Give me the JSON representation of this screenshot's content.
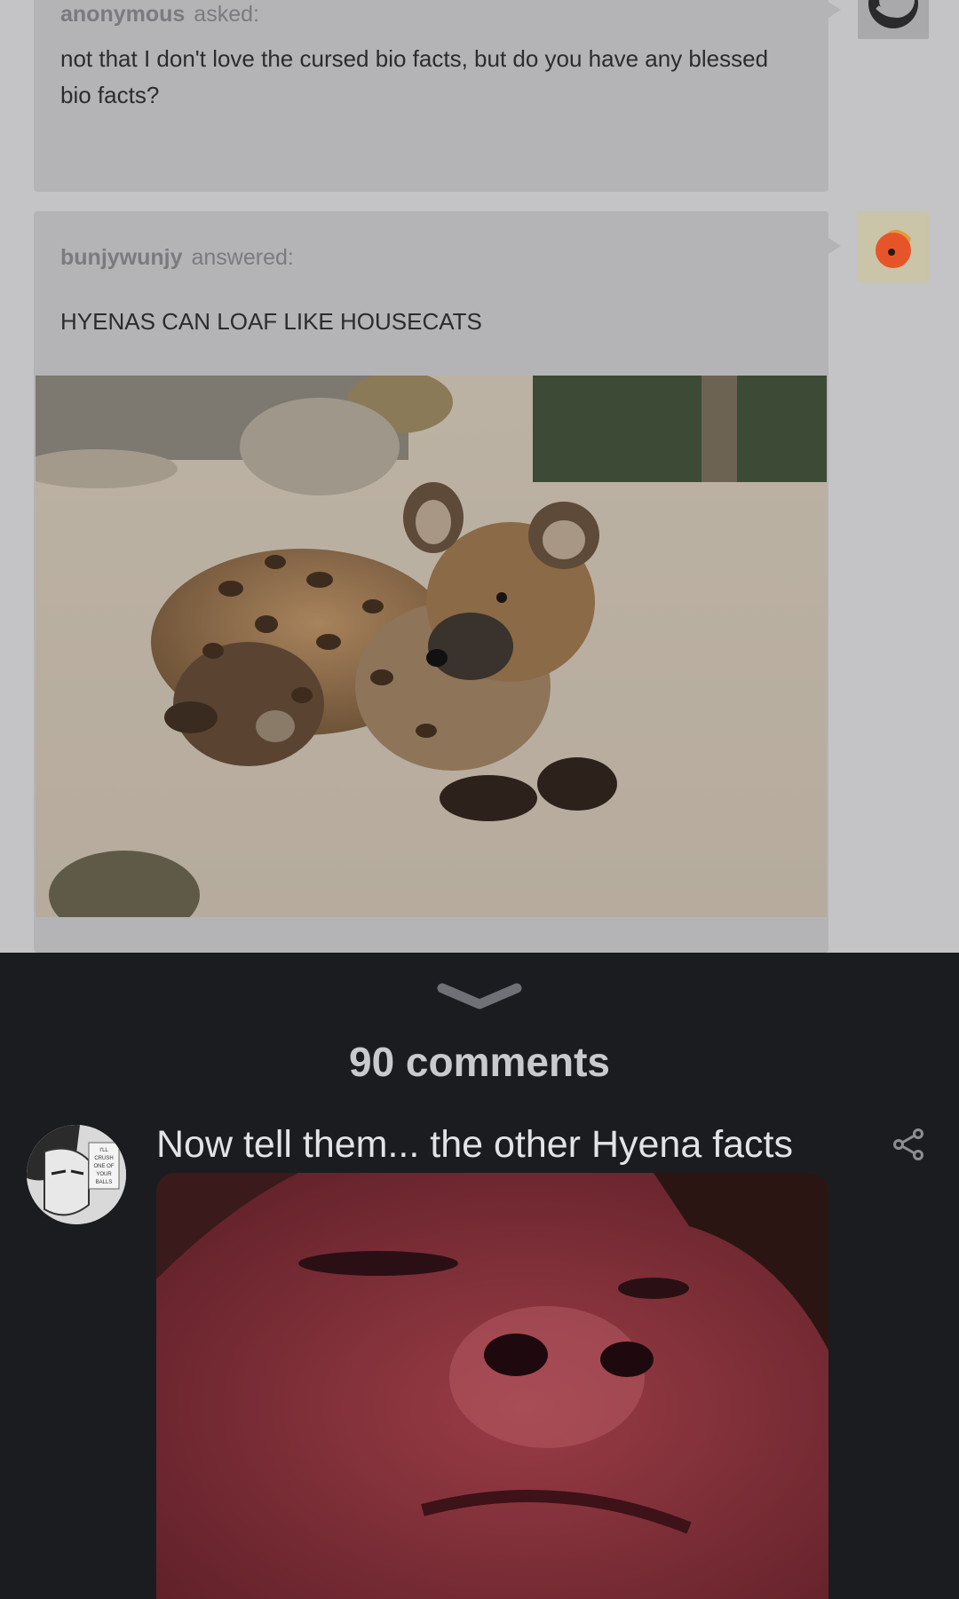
{
  "ask": {
    "username": "anonymous",
    "action": "asked:",
    "text": "not that I don't love the cursed bio facts, but do you have any blessed bio facts?"
  },
  "answer": {
    "username": "bunjywunjy",
    "action": "answered:",
    "text": "HYENAS CAN LOAF LIKE HOUSECATS",
    "image_icon": "hyena-photo"
  },
  "sheet": {
    "handle_icon": "chevron-down-icon",
    "comments_count": "90 comments"
  },
  "comment": {
    "text": "Now tell them... the other Hyena facts",
    "share_icon": "share-icon",
    "avatar_caption": [
      "I'LL",
      "CRUSH",
      "ONE OF",
      "YOUR",
      "BALLS"
    ]
  },
  "colors": {
    "dim_bg": "#c4c4c6",
    "card_bg": "#b4b4b7",
    "sheet_bg": "#1b1c20",
    "comment_text": "#e2e3e7"
  }
}
